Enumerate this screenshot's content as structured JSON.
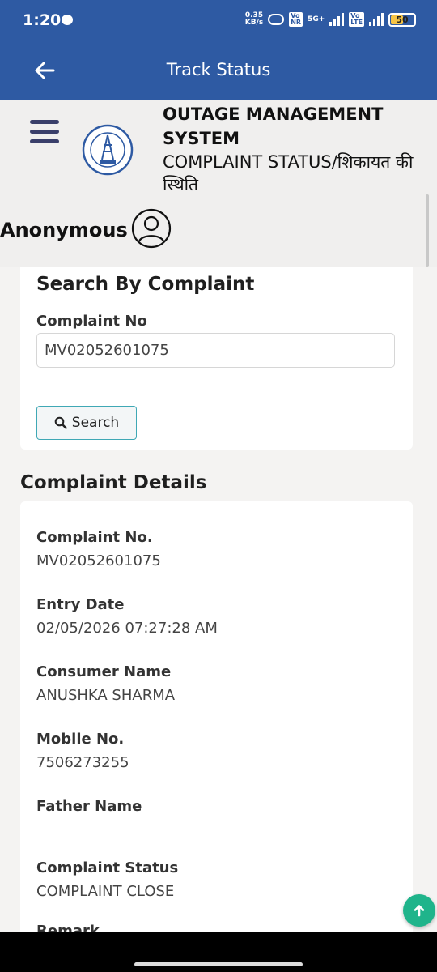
{
  "status_bar": {
    "time": "1:20",
    "speed_value": "0.35",
    "speed_unit": "KB/s",
    "net1_top": "Vo",
    "net1_bottom": "NR",
    "net_type": "5G+",
    "net2_top": "Vo",
    "net2_bottom": "LTE",
    "battery": "50"
  },
  "app_bar": {
    "title": "Track Status"
  },
  "header": {
    "title_line1": "OUTAGE MANAGEMENT",
    "title_line2": "SYSTEM",
    "subtitle": "COMPLAINT STATUS/शिकायत की स्थिति",
    "user_name": "Anonymous"
  },
  "search": {
    "title": "Search By Complaint",
    "field_label": "Complaint No",
    "field_value": "MV02052601075",
    "button_label": "Search"
  },
  "details": {
    "title": "Complaint Details",
    "rows": [
      {
        "label": "Complaint No.",
        "value": "MV02052601075"
      },
      {
        "label": "Entry Date",
        "value": "02/05/2026 07:27:28 AM"
      },
      {
        "label": "Consumer Name",
        "value": "ANUSHKA SHARMA"
      },
      {
        "label": "Mobile No.",
        "value": "7506273255"
      },
      {
        "label": "Father Name",
        "value": ""
      },
      {
        "label": "Complaint Status",
        "value": "COMPLAINT CLOSE"
      },
      {
        "label": "Remark",
        "value": ""
      }
    ]
  },
  "colors": {
    "primary": "#2e5aa3",
    "accent_teal": "#3fa8b5",
    "fab_green": "#1fb48b"
  }
}
